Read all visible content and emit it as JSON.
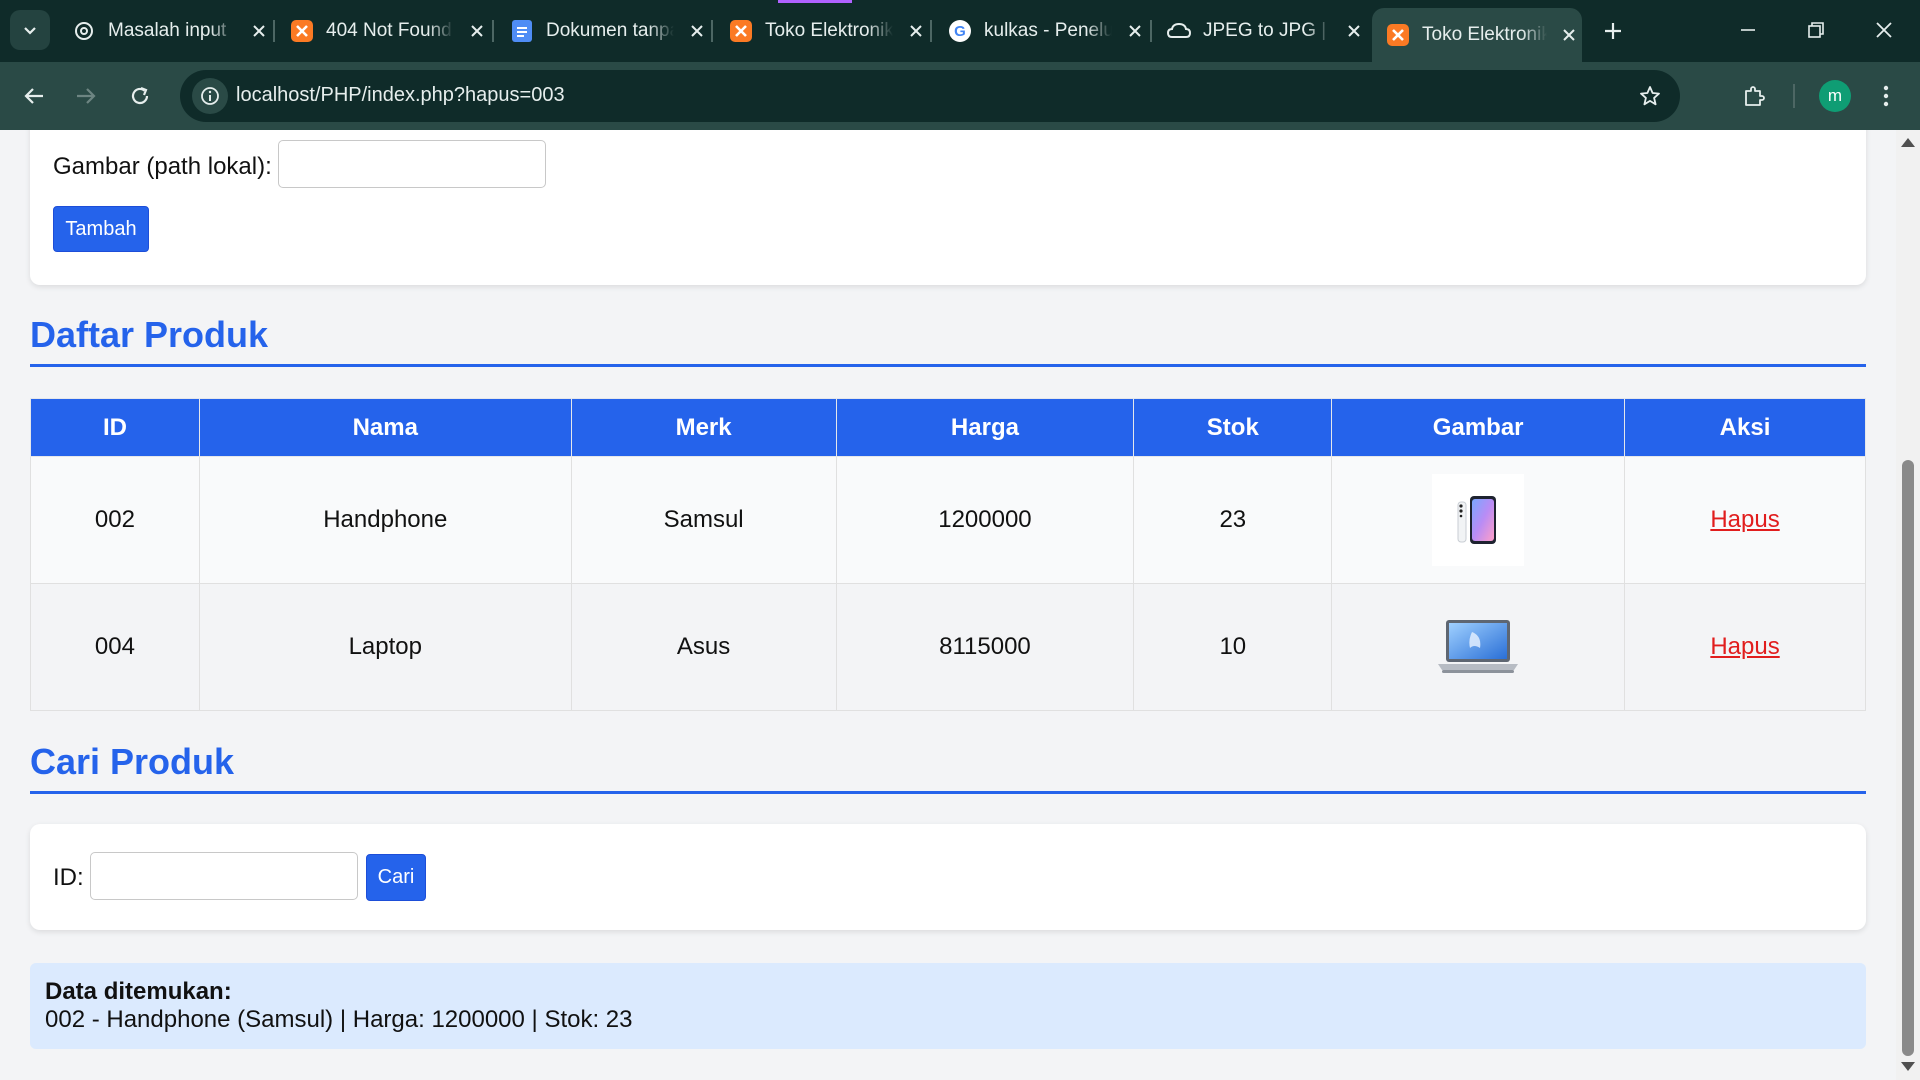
{
  "browser": {
    "tabs": [
      {
        "title": "Masalah input",
        "icon": "chatgpt-icon"
      },
      {
        "title": "404 Not Found",
        "icon": "xampp-icon"
      },
      {
        "title": "Dokumen tanpa judul",
        "icon": "google-docs-icon"
      },
      {
        "title": "Toko Elektronik",
        "icon": "xampp-icon"
      },
      {
        "title": "kulkas - Penelusuran",
        "icon": "google-icon"
      },
      {
        "title": "JPEG to JPG | Convert",
        "icon": "cloud-convert-icon"
      },
      {
        "title": "Toko Elektronik",
        "icon": "xampp-icon",
        "active": true
      }
    ],
    "url": "localhost/PHP/index.php?hapus=003",
    "profile_initial": "m",
    "accent_color": "#0f2b29"
  },
  "add_form": {
    "image_label": "Gambar (path lokal):",
    "image_value": "",
    "submit_label": "Tambah"
  },
  "product_list": {
    "title": "Daftar Produk",
    "columns": [
      "ID",
      "Nama",
      "Merk",
      "Harga",
      "Stok",
      "Gambar",
      "Aksi"
    ],
    "rows": [
      {
        "id": "002",
        "name": "Handphone",
        "brand": "Samsul",
        "price": "1200000",
        "stock": "23",
        "image": "phone-image",
        "action": "Hapus"
      },
      {
        "id": "004",
        "name": "Laptop",
        "brand": "Asus",
        "price": "8115000",
        "stock": "10",
        "image": "laptop-image",
        "action": "Hapus"
      }
    ]
  },
  "search": {
    "title": "Cari Produk",
    "id_label": "ID:",
    "id_value": "",
    "button_label": "Cari"
  },
  "result": {
    "title": "Data ditemukan:",
    "text": "002 - Handphone (Samsul) | Harga: 1200000 | Stok: 23"
  },
  "colors": {
    "primary": "#2563eb",
    "delete_link": "#e11d1d",
    "result_bg": "#dbeafe"
  }
}
